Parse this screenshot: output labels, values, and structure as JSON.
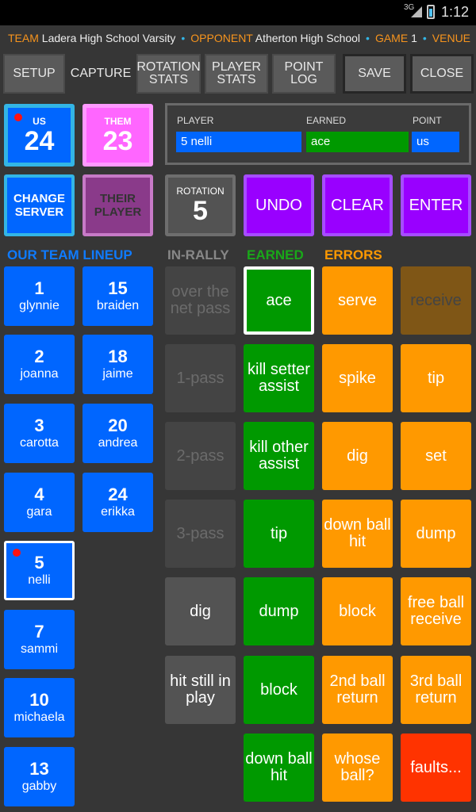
{
  "status": {
    "network": "3G",
    "time": "1:12"
  },
  "info": {
    "team_key": "TEAM",
    "team": "Ladera High School Varsity",
    "opponent_key": "OPPONENT",
    "opponent": "Atherton High School",
    "game_key": "GAME",
    "game": "1",
    "venue_key": "VENUE"
  },
  "tabs": {
    "setup": "SETUP",
    "capture": "CAPTURE",
    "rotation_stats": "ROTATION STATS",
    "player_stats": "PLAYER STATS",
    "point_log": "POINT LOG",
    "save": "SAVE",
    "close": "CLOSE"
  },
  "score": {
    "us_label": "US",
    "us": "24",
    "them_label": "THEM",
    "them": "23"
  },
  "entry": {
    "player_label": "PLAYER",
    "player_value": "5 nelli",
    "earned_label": "EARNED",
    "earned_value": "ace",
    "point_label": "POINT",
    "point_value": "us"
  },
  "controls": {
    "change_server": "CHANGE SERVER",
    "their_player": "THEIR PLAYER",
    "rotation_label": "ROTATION",
    "rotation_value": "5",
    "undo": "UNDO",
    "clear": "CLEAR",
    "enter": "ENTER"
  },
  "headers": {
    "lineup": "OUR TEAM LINEUP",
    "in_rally": "IN-RALLY",
    "earned": "EARNED",
    "errors": "ERRORS"
  },
  "lineup": [
    {
      "num": "1",
      "name": "glynnie"
    },
    {
      "num": "15",
      "name": "braiden"
    },
    {
      "num": "2",
      "name": "joanna"
    },
    {
      "num": "18",
      "name": "jaime"
    },
    {
      "num": "3",
      "name": "carotta"
    },
    {
      "num": "20",
      "name": "andrea"
    },
    {
      "num": "4",
      "name": "gara"
    },
    {
      "num": "24",
      "name": "erikka"
    },
    {
      "num": "5",
      "name": "nelli"
    },
    {
      "num": "7",
      "name": "sammi"
    },
    {
      "num": "10",
      "name": "michaela"
    },
    {
      "num": "13",
      "name": "gabby"
    }
  ],
  "in_rally": [
    "over the net pass",
    "1-pass",
    "2-pass",
    "3-pass",
    "dig",
    "hit still in play"
  ],
  "earned": [
    "ace",
    "kill setter assist",
    "kill other assist",
    "tip",
    "dump",
    "block",
    "down ball hit"
  ],
  "errors": [
    "serve",
    "receive",
    "spike",
    "tip",
    "dig",
    "set",
    "down ball hit",
    "dump",
    "block",
    "free ball receive",
    "2nd ball return",
    "3rd ball return",
    "whose ball?",
    "faults..."
  ],
  "colors": {
    "blue": "#0066ff",
    "green": "#009900",
    "orange": "#ff9900",
    "purple": "#9900ff",
    "pink": "#ff66ff",
    "error_red": "#ff3300"
  }
}
